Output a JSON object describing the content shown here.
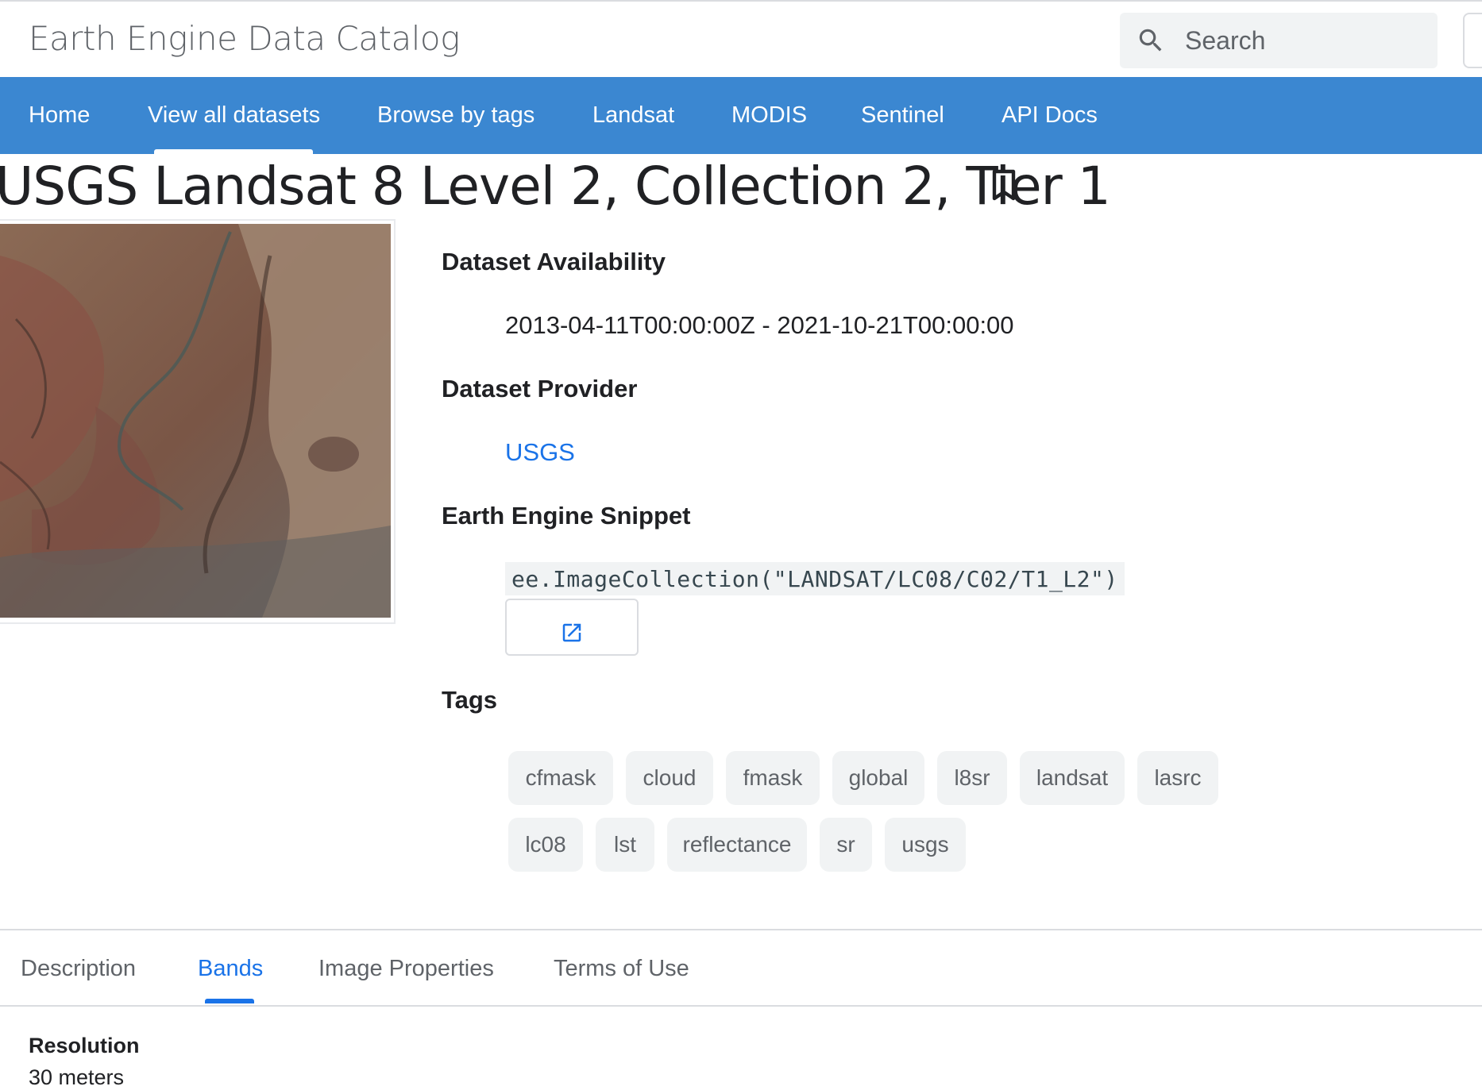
{
  "header": {
    "site_title": "Earth Engine Data Catalog",
    "search_placeholder": "Search"
  },
  "nav": {
    "items": [
      {
        "label": "Home"
      },
      {
        "label": "View all datasets",
        "active": true
      },
      {
        "label": "Browse by tags"
      },
      {
        "label": "Landsat"
      },
      {
        "label": "MODIS"
      },
      {
        "label": "Sentinel"
      },
      {
        "label": "API Docs"
      }
    ]
  },
  "dataset": {
    "title": "USGS Landsat 8 Level 2, Collection 2, Tier 1",
    "availability_heading": "Dataset Availability",
    "availability_value": "2013-04-11T00:00:00Z - 2021-10-21T00:00:00",
    "provider_heading": "Dataset Provider",
    "provider_value": "USGS",
    "snippet_heading": "Earth Engine Snippet",
    "snippet_value": "ee.ImageCollection(\"LANDSAT/LC08/C02/T1_L2\")",
    "tags_heading": "Tags",
    "tags": [
      "cfmask",
      "cloud",
      "fmask",
      "global",
      "l8sr",
      "landsat",
      "lasrc",
      "lc08",
      "lst",
      "reflectance",
      "sr",
      "usgs"
    ]
  },
  "tabs": [
    {
      "label": "Description"
    },
    {
      "label": "Bands",
      "active": true
    },
    {
      "label": "Image Properties"
    },
    {
      "label": "Terms of Use"
    }
  ],
  "bands": {
    "resolution_label": "Resolution",
    "resolution_value": "30 meters"
  },
  "colors": {
    "nav_bg": "#3b87d1",
    "link_blue": "#1a73e8",
    "tag_bg": "#f1f3f4"
  },
  "icons": {
    "search": "search-icon",
    "bookmark": "bookmark-icon",
    "open": "open-in-new-icon"
  }
}
